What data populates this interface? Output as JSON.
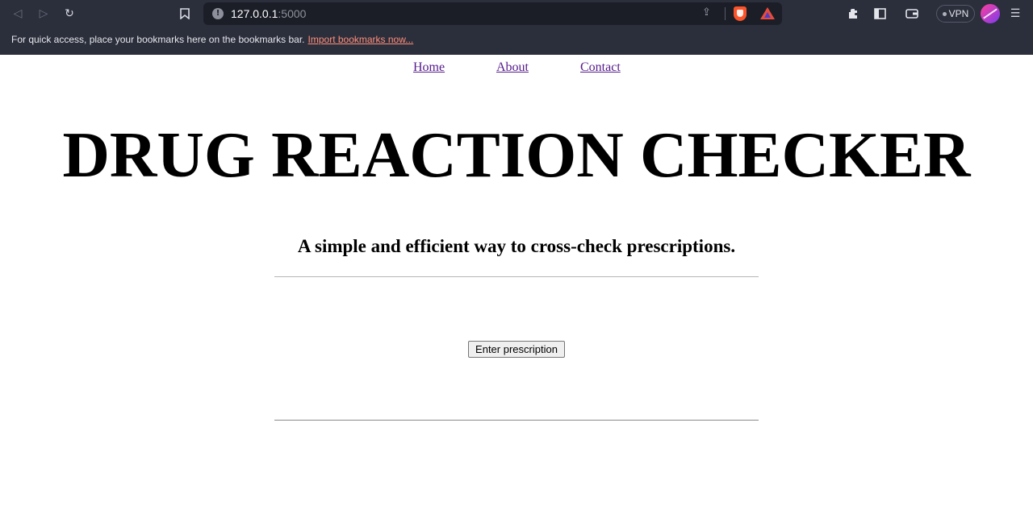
{
  "browser": {
    "url_host": "127.0.0.1",
    "url_port": ":5000",
    "vpn_label": "VPN",
    "bookmarks_bar": {
      "message": "For quick access, place your bookmarks here on the bookmarks bar.",
      "import_link": "Import bookmarks now..."
    }
  },
  "nav": {
    "items": [
      {
        "label": "Home"
      },
      {
        "label": "About"
      },
      {
        "label": "Contact"
      }
    ]
  },
  "main": {
    "title": "DRUG REACTION CHECKER",
    "subtitle": "A simple and efficient way to cross-check prescriptions.",
    "enter_button_label": "Enter prescription"
  }
}
